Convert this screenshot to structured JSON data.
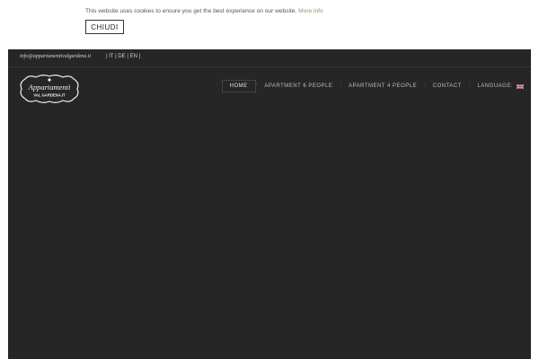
{
  "cookie": {
    "message": "This website uses cookies to ensure you get the best experience on our website.",
    "more_info": "More info",
    "close_label": "CHIUDI"
  },
  "topbar": {
    "email": "info@appartamentivalgardena.it",
    "languages": "| IT | DE | EN |"
  },
  "logo": {
    "line1": "Appartamenti",
    "line2": "VAL GARDENA.IT"
  },
  "nav": {
    "items": [
      {
        "label": "HOME",
        "active": true
      },
      {
        "label": "APARTMENT 6 PEOPLE"
      },
      {
        "label": "APARTMENT 4 PEOPLE"
      },
      {
        "label": "CONTACT"
      },
      {
        "label": "LANGUAGE:"
      }
    ],
    "language_flag": "uk-flag-icon"
  },
  "colors": {
    "site_bg": "#262626",
    "accent_link": "#9a8f5e"
  }
}
